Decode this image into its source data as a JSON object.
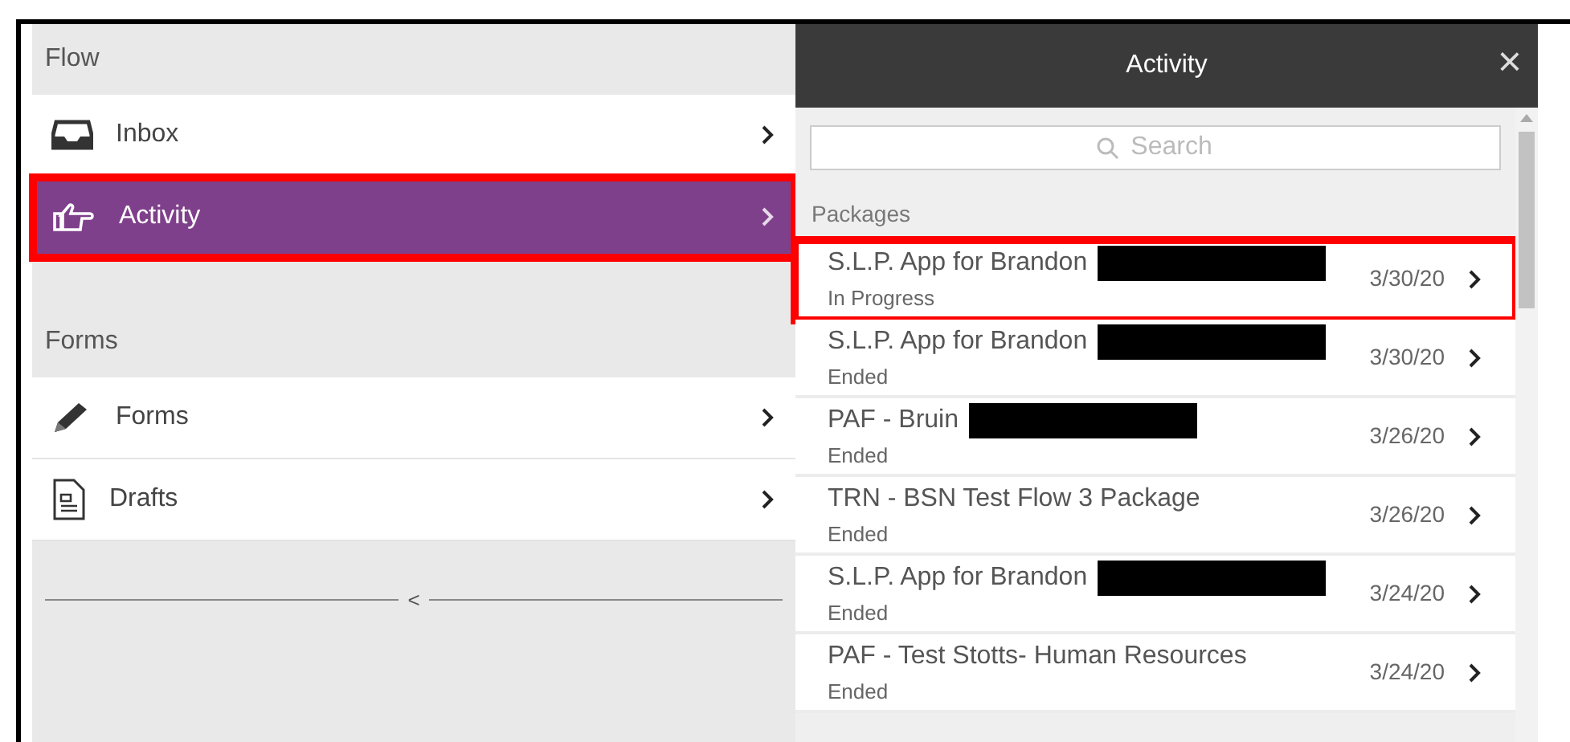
{
  "nav": {
    "sections": [
      {
        "title": "Flow",
        "items": [
          {
            "label": "Inbox",
            "kind": "inbox",
            "selected": false,
            "annotated": false
          },
          {
            "label": "Activity",
            "kind": "hand",
            "selected": true,
            "annotated": true
          }
        ]
      },
      {
        "title": "Forms",
        "items": [
          {
            "label": "Forms",
            "kind": "pencil",
            "selected": false,
            "annotated": false
          },
          {
            "label": "Drafts",
            "kind": "document",
            "selected": false,
            "annotated": false
          }
        ]
      }
    ],
    "collapse_glyph": "<"
  },
  "panel": {
    "title": "Activity",
    "close": "×",
    "search": {
      "placeholder": "Search"
    },
    "section": "Packages",
    "rows": [
      {
        "title": "S.L.P. App for Brandon",
        "redacted": true,
        "status": "In Progress",
        "date": "3/30/20",
        "annotated": true
      },
      {
        "title": "S.L.P. App for Brandon",
        "redacted": true,
        "status": "Ended",
        "date": "3/30/20",
        "annotated": false
      },
      {
        "title": "PAF - Bruin",
        "redacted": true,
        "status": "Ended",
        "date": "3/26/20",
        "annotated": false
      },
      {
        "title": "TRN - BSN Test Flow 3 Package",
        "redacted": false,
        "status": "Ended",
        "date": "3/26/20",
        "annotated": false
      },
      {
        "title": "S.L.P. App for Brandon",
        "redacted": true,
        "status": "Ended",
        "date": "3/24/20",
        "annotated": false
      },
      {
        "title": "PAF - Test Stotts- Human Resources",
        "redacted": false,
        "status": "Ended",
        "date": "3/24/20",
        "annotated": false
      }
    ]
  }
}
